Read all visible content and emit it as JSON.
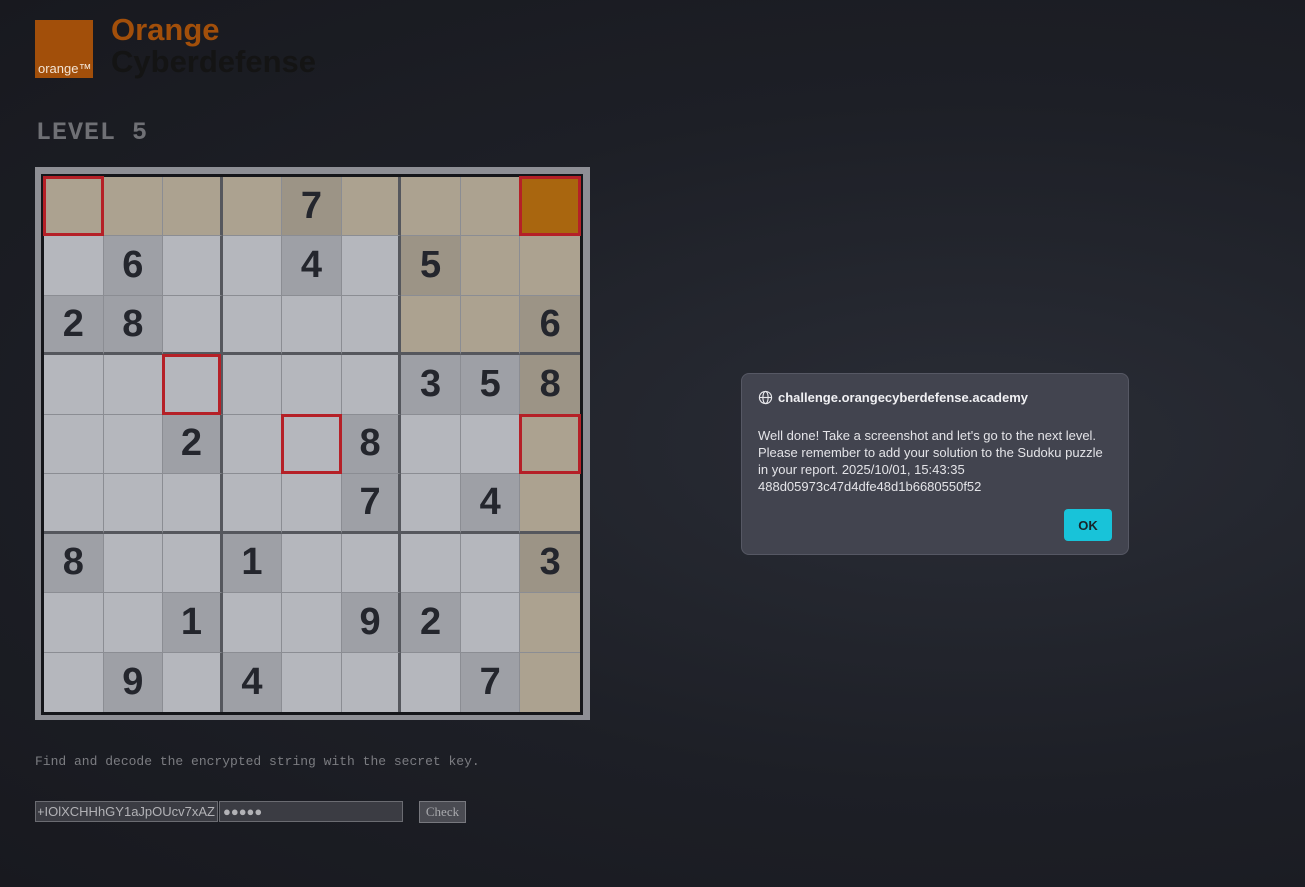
{
  "logo": {
    "badge": "orange™",
    "brand": "Orange",
    "sub": "Cyberdefense"
  },
  "level_title": "LEVEL 5",
  "colors": {
    "cell_light": "#b5b7bd",
    "cell_given": "#9ea0a6",
    "cell_tan": "#aca290",
    "cell_tan_given": "#9c9486",
    "cell_orange": "#a9660f",
    "highlight_border": "#b52027",
    "ok_button": "#18c3d9"
  },
  "sudoku": {
    "rows": [
      [
        "",
        "",
        "",
        "",
        "7",
        "",
        "",
        "",
        ""
      ],
      [
        "",
        "6",
        "",
        "",
        "4",
        "",
        "5",
        "",
        ""
      ],
      [
        "2",
        "8",
        "",
        "",
        "",
        "",
        "",
        "",
        "6"
      ],
      [
        "",
        "",
        "",
        "",
        "",
        "",
        "3",
        "5",
        "8"
      ],
      [
        "",
        "",
        "2",
        "",
        "",
        "8",
        "",
        "",
        ""
      ],
      [
        "",
        "",
        "",
        "",
        "",
        "7",
        "",
        "4",
        ""
      ],
      [
        "8",
        "",
        "",
        "1",
        "",
        "",
        "",
        "",
        "3"
      ],
      [
        "",
        "",
        "1",
        "",
        "",
        "9",
        "2",
        "",
        ""
      ],
      [
        "",
        "9",
        "",
        "4",
        "",
        "",
        "",
        "7",
        ""
      ]
    ],
    "tan_cells": [
      [
        0,
        0
      ],
      [
        0,
        1
      ],
      [
        0,
        2
      ],
      [
        0,
        3
      ],
      [
        0,
        4
      ],
      [
        0,
        5
      ],
      [
        0,
        6
      ],
      [
        0,
        7
      ],
      [
        1,
        6
      ],
      [
        1,
        7
      ],
      [
        1,
        8
      ],
      [
        2,
        6
      ],
      [
        2,
        7
      ],
      [
        2,
        8
      ],
      [
        3,
        8
      ],
      [
        4,
        8
      ],
      [
        5,
        8
      ],
      [
        6,
        8
      ],
      [
        7,
        8
      ],
      [
        8,
        8
      ]
    ],
    "orange_cells": [
      [
        0,
        8
      ]
    ],
    "highlighted_cells": [
      [
        0,
        0
      ],
      [
        0,
        8
      ],
      [
        3,
        2
      ],
      [
        4,
        4
      ],
      [
        4,
        8
      ]
    ]
  },
  "hint_text": "Find and decode the encrypted string with the secret key.",
  "inputs": {
    "encrypted_value": "ı+IOlXCHHhGY1aJpOUcv7xAZ",
    "key_value": "●●●●●",
    "check_label": "Check"
  },
  "dialog": {
    "origin": "challenge.orangecyberdefense.academy",
    "message_lines": [
      "Well done! Take a screenshot and let's go to the next level.",
      "Please remember to add your solution to the Sudoku puzzle",
      "in your report. 2025/10/01, 15:43:35",
      "488d05973c47d4dfe48d1b6680550f52"
    ],
    "ok_label": "OK"
  }
}
